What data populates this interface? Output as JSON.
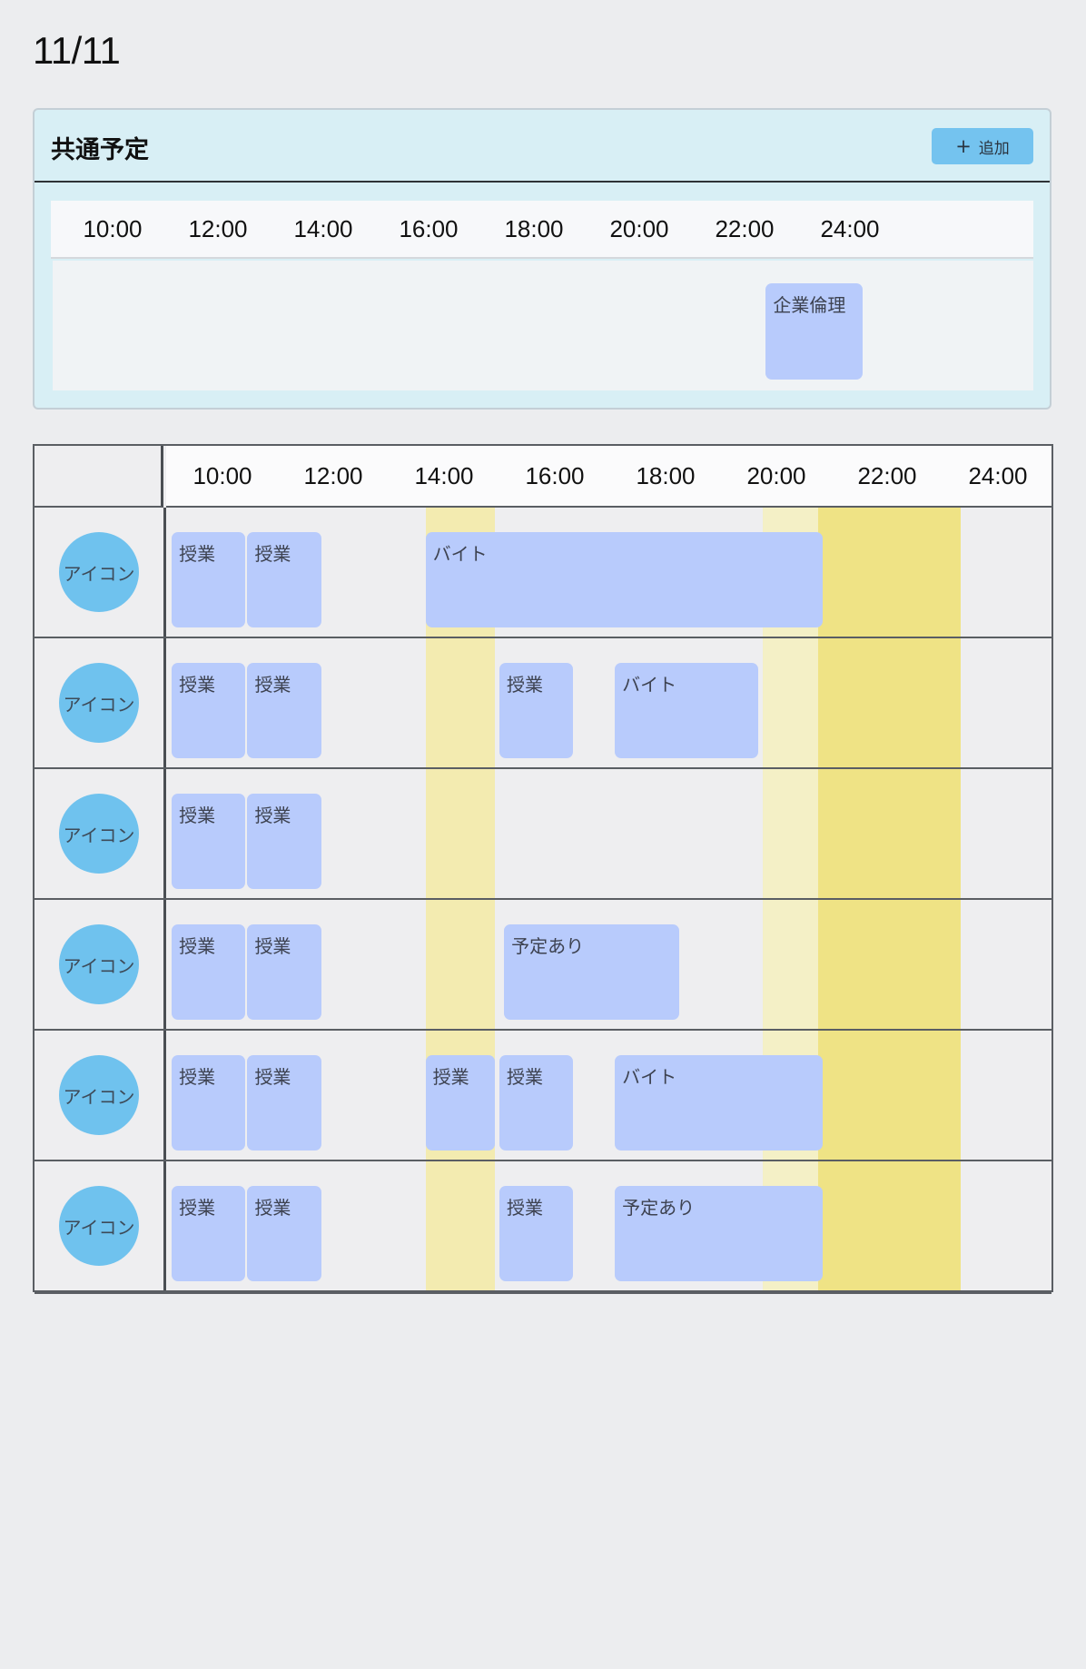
{
  "date": "11/11",
  "time_labels": [
    "10:00",
    "12:00",
    "14:00",
    "16:00",
    "18:00",
    "20:00",
    "22:00",
    "24:00"
  ],
  "common": {
    "title": "共通予定",
    "add_button": {
      "icon": "plus-icon",
      "label": "追加"
    },
    "events": [
      {
        "label": "企業倫理",
        "start": "22:20",
        "end": "24:10"
      }
    ]
  },
  "members": {
    "highlight_bands": [
      {
        "start": "13:40",
        "end": "14:55",
        "color": "#f3ebb0"
      },
      {
        "start": "19:45",
        "end": "20:45",
        "color": "#f4f0c6"
      },
      {
        "start": "20:45",
        "end": "23:20",
        "color": "#efe385"
      }
    ],
    "rows": [
      {
        "avatar": "アイコン",
        "events": [
          {
            "label": "授業",
            "start": "9:05",
            "end": "10:25"
          },
          {
            "label": "授業",
            "start": "10:27",
            "end": "11:47"
          },
          {
            "label": "バイト",
            "start": "13:40",
            "end": "20:50"
          }
        ]
      },
      {
        "avatar": "アイコン",
        "events": [
          {
            "label": "授業",
            "start": "9:05",
            "end": "10:25"
          },
          {
            "label": "授業",
            "start": "10:27",
            "end": "11:47"
          },
          {
            "label": "授業",
            "start": "15:00",
            "end": "16:20"
          },
          {
            "label": "バイト",
            "start": "17:05",
            "end": "19:40"
          }
        ]
      },
      {
        "avatar": "アイコン",
        "events": [
          {
            "label": "授業",
            "start": "9:05",
            "end": "10:25"
          },
          {
            "label": "授業",
            "start": "10:27",
            "end": "11:47"
          }
        ]
      },
      {
        "avatar": "アイコン",
        "events": [
          {
            "label": "授業",
            "start": "9:05",
            "end": "10:25"
          },
          {
            "label": "授業",
            "start": "10:27",
            "end": "11:47"
          },
          {
            "label": "予定あり",
            "start": "15:05",
            "end": "18:15"
          }
        ]
      },
      {
        "avatar": "アイコン",
        "events": [
          {
            "label": "授業",
            "start": "9:05",
            "end": "10:25"
          },
          {
            "label": "授業",
            "start": "10:27",
            "end": "11:47"
          },
          {
            "label": "授業",
            "start": "13:40",
            "end": "14:55"
          },
          {
            "label": "授業",
            "start": "15:00",
            "end": "16:20"
          },
          {
            "label": "バイト",
            "start": "17:05",
            "end": "20:50"
          }
        ]
      },
      {
        "avatar": "アイコン",
        "events": [
          {
            "label": "授業",
            "start": "9:05",
            "end": "10:25"
          },
          {
            "label": "授業",
            "start": "10:27",
            "end": "11:47"
          },
          {
            "label": "授業",
            "start": "15:00",
            "end": "16:20"
          },
          {
            "label": "予定あり",
            "start": "17:05",
            "end": "20:50"
          }
        ]
      }
    ]
  }
}
